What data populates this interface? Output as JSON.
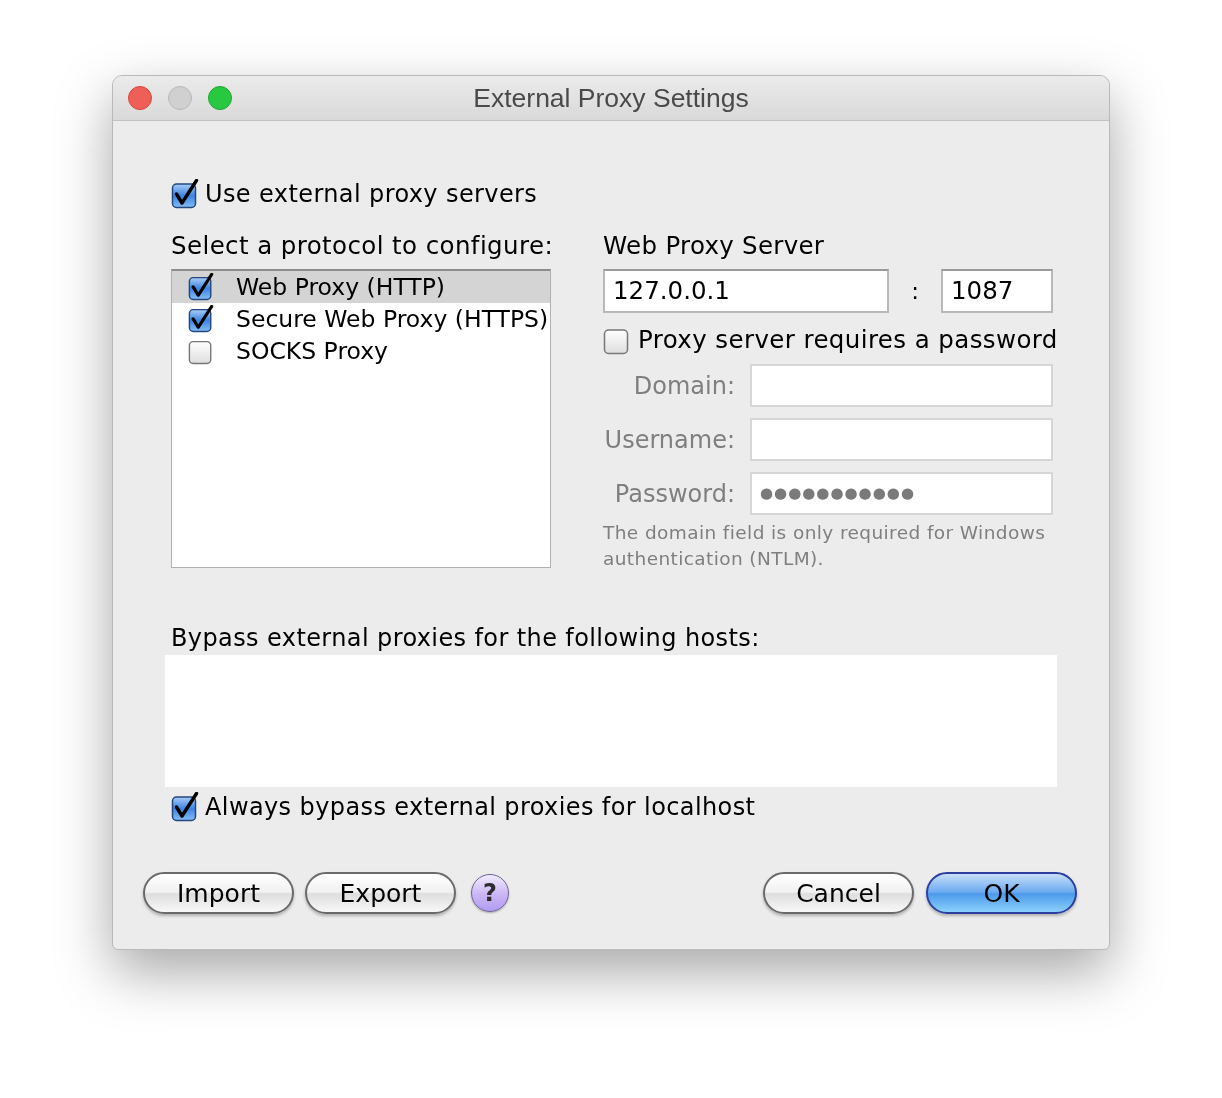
{
  "window": {
    "title": "External Proxy Settings",
    "controls": [
      {
        "kind": "close",
        "disabled": false
      },
      {
        "kind": "minimize",
        "disabled": true
      },
      {
        "kind": "zoom",
        "disabled": false
      }
    ]
  },
  "use_external_proxy": {
    "label": "Use external proxy servers",
    "checked": true
  },
  "protocols": {
    "label": "Select a protocol to configure:",
    "items": [
      {
        "label": "Web Proxy (HTTP)",
        "checked": true,
        "selected": true
      },
      {
        "label": "Secure Web Proxy (HTTPS)",
        "checked": true,
        "selected": false
      },
      {
        "label": "SOCKS Proxy",
        "checked": false,
        "selected": false
      }
    ]
  },
  "server": {
    "heading": "Web Proxy Server",
    "host": "127.0.0.1",
    "separator": ":",
    "port": "1087"
  },
  "requires_password": {
    "label": "Proxy server requires a password",
    "checked": false
  },
  "auth_fields": [
    {
      "label": "Domain:",
      "disabled": true
    },
    {
      "label": "Username:",
      "disabled": true
    },
    {
      "label": "Password:",
      "value": "●●●●●●●●●●●",
      "disabled": true
    }
  ],
  "auth_note": "The domain field is only required for Windows authentication (NTLM).",
  "bypass": {
    "label": "Bypass external proxies for the following hosts:"
  },
  "always_bypass_localhost": {
    "label": "Always bypass external proxies for localhost",
    "checked": true
  },
  "buttons_left": [
    {
      "label": "Import",
      "kind": "normal"
    },
    {
      "label": "Export",
      "kind": "normal"
    },
    {
      "label": "?",
      "kind": "help"
    }
  ],
  "buttons_right": [
    {
      "label": "Cancel",
      "kind": "normal"
    },
    {
      "label": "OK",
      "kind": "default"
    }
  ]
}
